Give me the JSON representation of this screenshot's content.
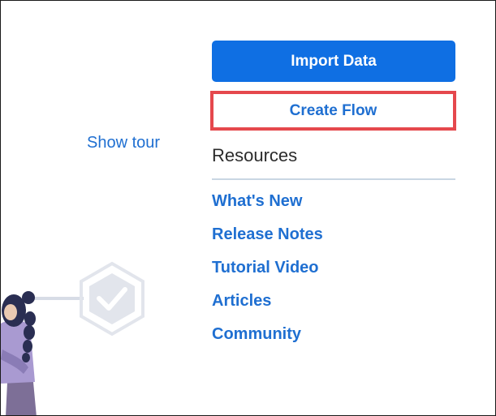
{
  "actions": {
    "import_label": "Import Data",
    "create_label": "Create Flow"
  },
  "tour": {
    "label": "Show tour"
  },
  "resources": {
    "heading": "Resources",
    "links": [
      {
        "label": "What's New"
      },
      {
        "label": "Release Notes"
      },
      {
        "label": "Tutorial Video"
      },
      {
        "label": "Articles"
      },
      {
        "label": "Community"
      }
    ]
  },
  "colors": {
    "primary": "#0f6fe3",
    "link": "#1f6fd1",
    "highlight_border": "#e5484d",
    "divider": "#c9d6e3"
  },
  "icons": {
    "illustration": "person-with-checkmark-hexagon"
  }
}
